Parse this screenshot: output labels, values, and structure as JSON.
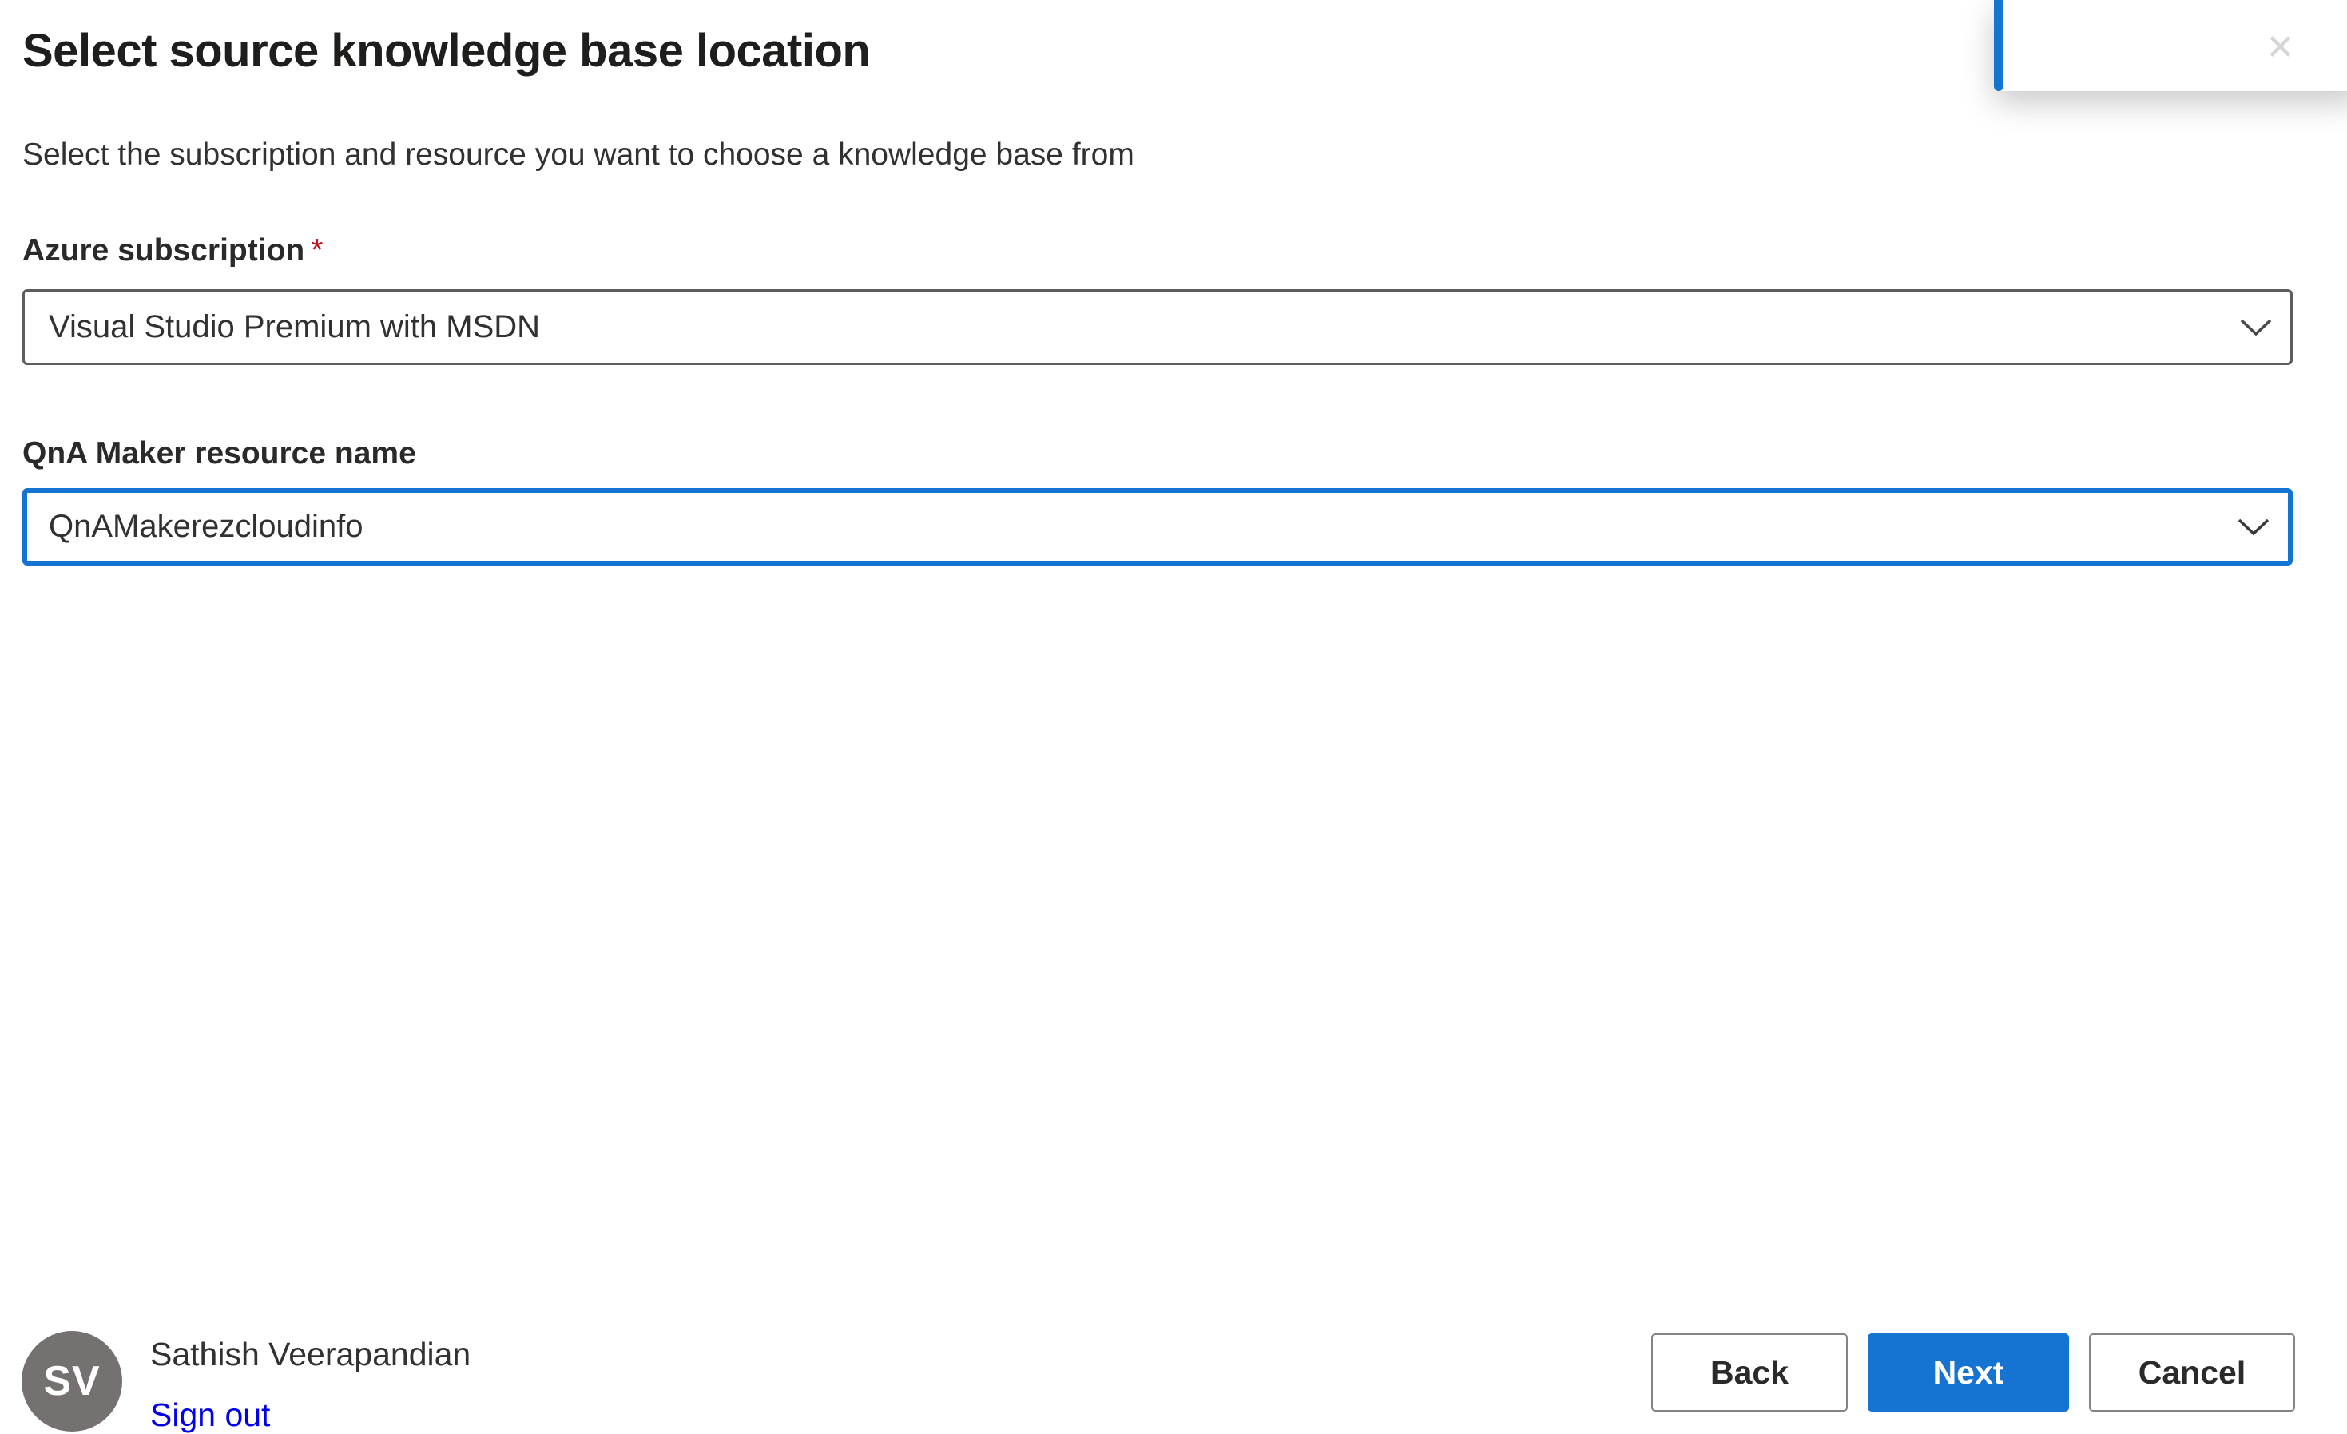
{
  "colors": {
    "accent": "#1574d1",
    "required_marker": "#c50f1f",
    "link": "#0000ee",
    "avatar_background": "#757170",
    "field_border": "#5f5d5b"
  },
  "header": {
    "title": "Select source knowledge base location",
    "subtitle": "Select the subscription and resource you want to choose a knowledge base from"
  },
  "form": {
    "subscription": {
      "label": "Azure subscription",
      "required_marker": "*",
      "value": "Visual Studio Premium with MSDN"
    },
    "resource": {
      "label": "QnA Maker resource name",
      "value": "QnAMakerezcloudinfo"
    }
  },
  "toast": {
    "close_glyph": "✕"
  },
  "footer": {
    "user": {
      "initials": "SV",
      "name": "Sathish Veerapandian",
      "sign_out_label": "Sign out"
    },
    "buttons": {
      "back": "Back",
      "next": "Next",
      "cancel": "Cancel"
    }
  }
}
